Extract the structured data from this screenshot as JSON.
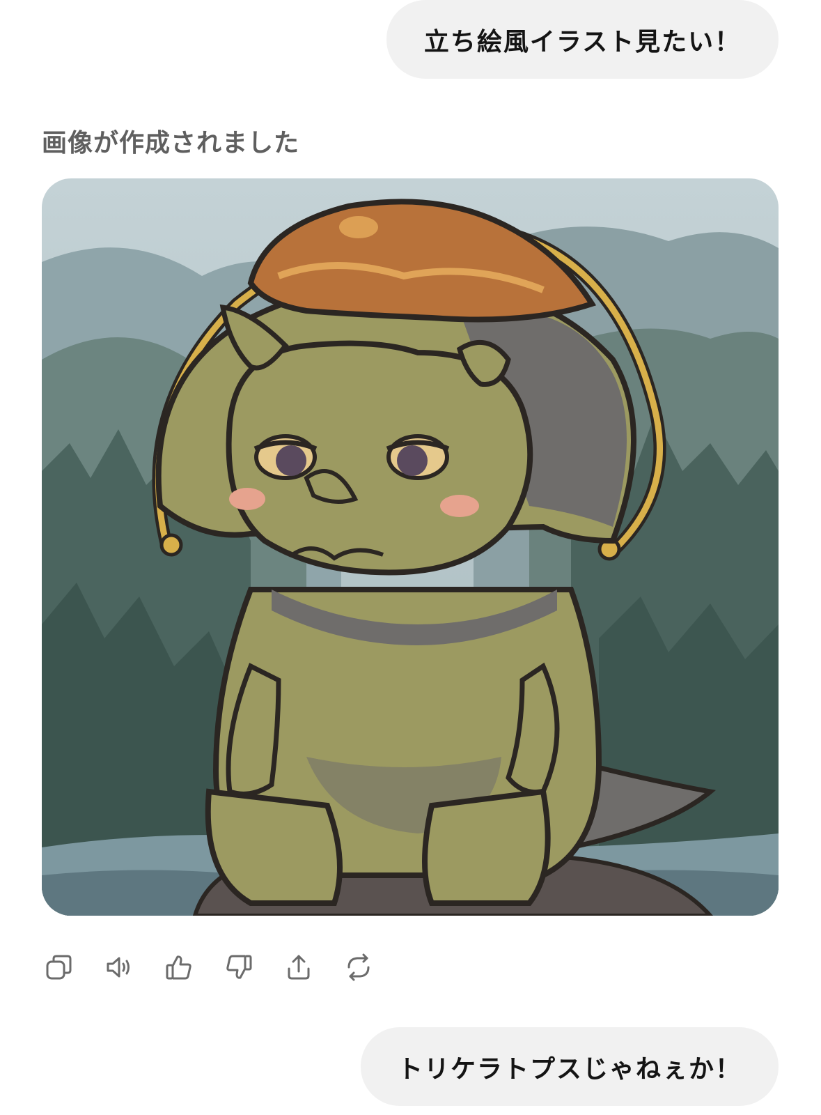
{
  "messages": {
    "user_first": "立ち絵風イラスト見たい！",
    "assistant_status": "画像が作成されました",
    "user_second": "トリケラトプスじゃねぇか！"
  },
  "image": {
    "alt": "generated image",
    "palette": {
      "sky": "#b9c8cc",
      "forest_dark": "#3f5a55",
      "forest_mid": "#5b7670",
      "water": "#7b97a0",
      "body_green": "#9c9a61",
      "body_shadow": "#6f6d6b",
      "outline": "#2b2622",
      "frill_ring": "#d8b04a",
      "hat_brown": "#b8723a",
      "cheek": "#e6a38e"
    }
  },
  "actions": [
    {
      "icon": "copy-icon"
    },
    {
      "icon": "speaker-icon"
    },
    {
      "icon": "thumbs-up-icon"
    },
    {
      "icon": "thumbs-down-icon"
    },
    {
      "icon": "share-icon"
    },
    {
      "icon": "regenerate-icon"
    }
  ]
}
